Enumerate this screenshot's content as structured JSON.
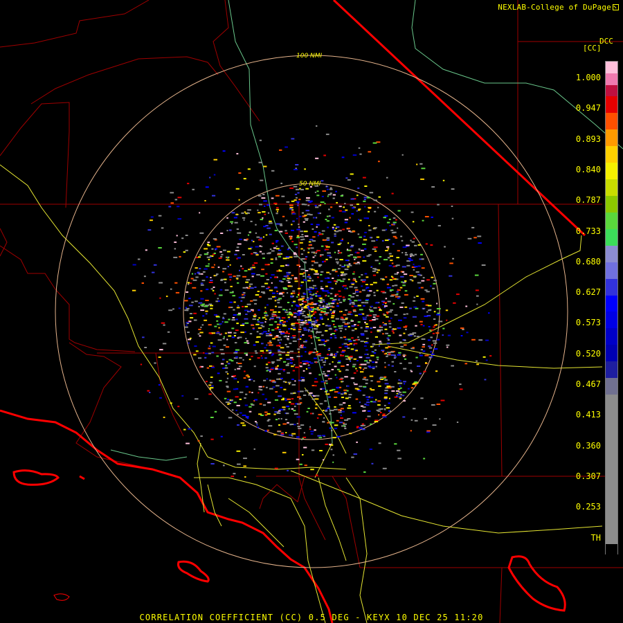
{
  "header": {
    "credit": "NEXLAB-College of DuPage",
    "credit_icon": "external-link-icon",
    "product_code": "DCC",
    "unit": "[CC]"
  },
  "rings": [
    {
      "label": "100 NMI"
    },
    {
      "label": "50 NMI"
    }
  ],
  "colorbar": {
    "labels": [
      "1.000",
      "0.947",
      "0.893",
      "0.840",
      "0.787",
      "0.733",
      "0.680",
      "0.627",
      "0.573",
      "0.520",
      "0.467",
      "0.413",
      "0.360",
      "0.307",
      "0.253",
      "TH"
    ],
    "colors_top_to_bottom": [
      "#ffc0dc",
      "#f07ab0",
      "#c01040",
      "#e60000",
      "#ff5000",
      "#ff9a00",
      "#ffd000",
      "#f5f000",
      "#c8dc00",
      "#8cc800",
      "#5ad73c",
      "#3cdc5a",
      "#8c8cd2",
      "#7070e0",
      "#3232dc",
      "#0000ff",
      "#0000e6",
      "#0000c8",
      "#0000b4",
      "#1e1ea0",
      "#707090",
      "#8c8c8c",
      "#000000"
    ]
  },
  "map_colors": {
    "background": "#000000",
    "counties": "#a00000",
    "coast": "#ff0000",
    "roads": "#e6e632",
    "rivers": "#6ac88c",
    "rings": "#e6b48c"
  },
  "footer": {
    "title": "CORRELATION COEFFICIENT (CC) 0.5 DEG - KEYX 10 DEC 25 11:20"
  }
}
